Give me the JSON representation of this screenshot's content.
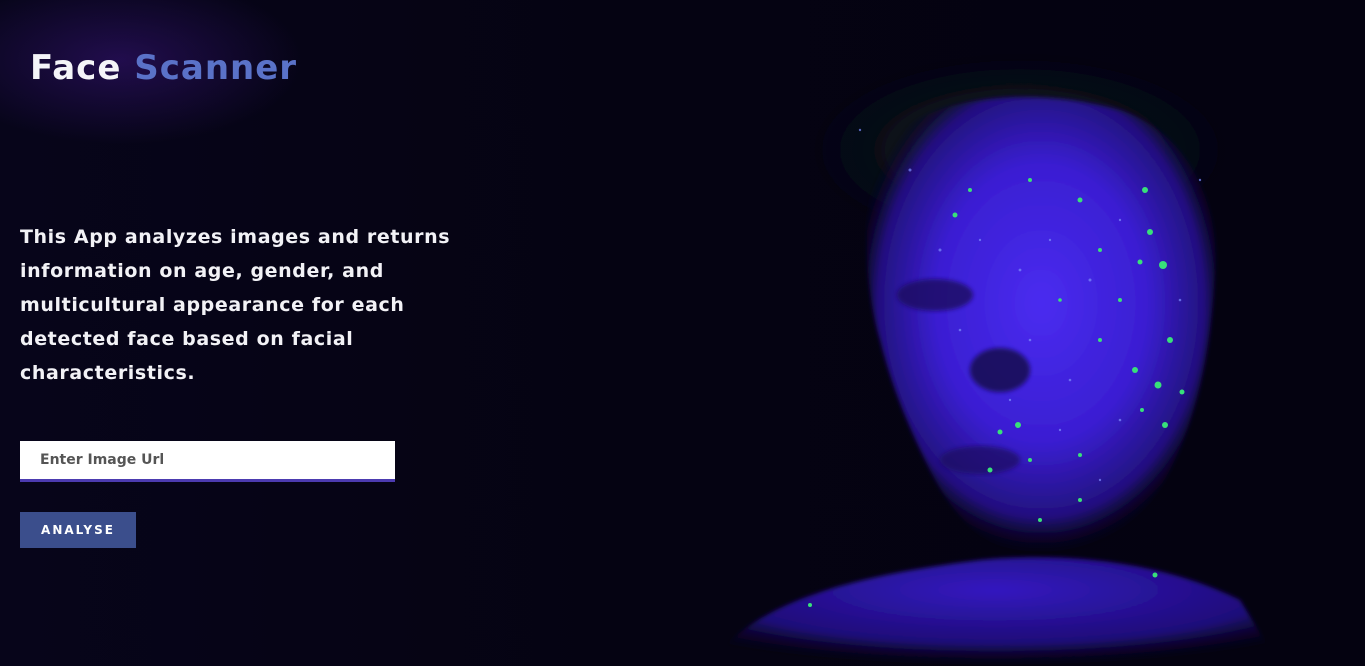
{
  "header": {
    "logo_word1": "Face",
    "logo_word2": "Scanner"
  },
  "main": {
    "description": "This App analyzes images and returns information on age, gender, and multicultural appearance for each detected face based on facial characteristics.",
    "input": {
      "value": "",
      "placeholder": "Enter Image Url"
    },
    "button_label": "ANALYSE"
  },
  "colors": {
    "background": "#05030f",
    "logo_accent": "#5a72c8",
    "button": "#3b4e8c",
    "input_border": "#4c3bb0",
    "face_glow": "#3d1fd8",
    "speckle": "#38e07a"
  },
  "hero_image": {
    "icon": "uv-face-photo-icon"
  }
}
